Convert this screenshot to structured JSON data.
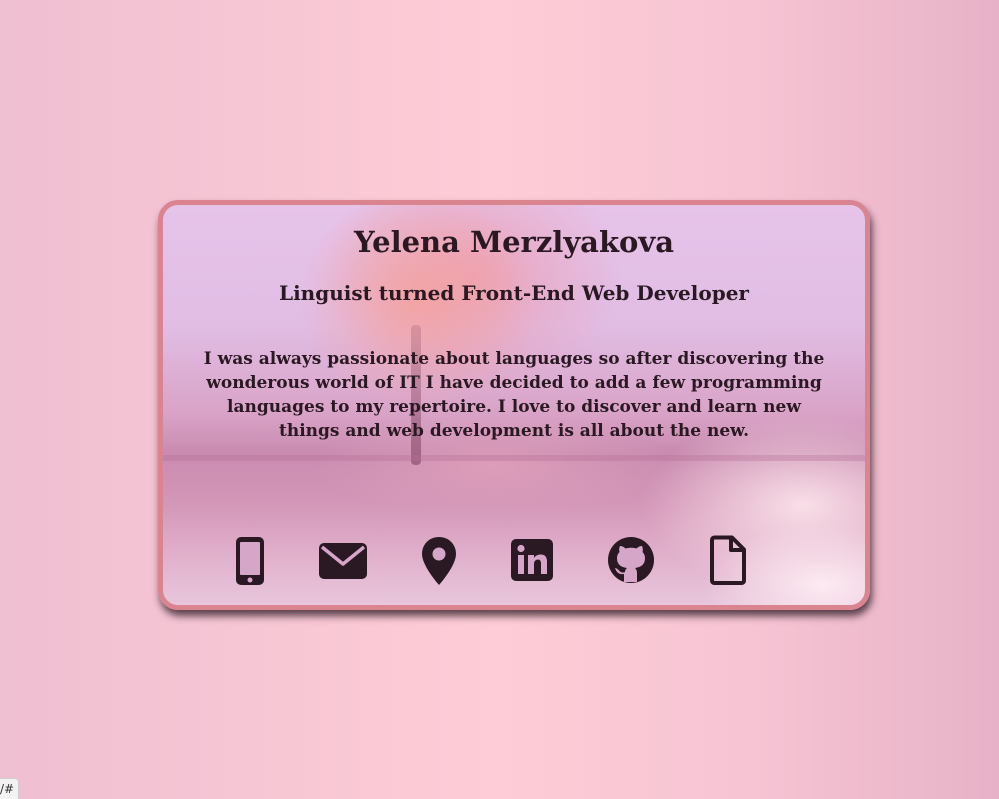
{
  "card": {
    "name": "Yelena Merzlyakova",
    "subtitle": "Linguist turned Front-End Web Developer",
    "bio": "I was always passionate about languages so after discovering the wonderous world of IT I have decided to add a few programming languages to my repertoire. I love to discover and learn new things and web development is all about the new.",
    "contact_icons": [
      "phone-icon",
      "email-icon",
      "location-icon",
      "linkedin-icon",
      "github-icon",
      "file-icon"
    ]
  },
  "status_bar": {
    "url": "/#"
  },
  "colors": {
    "text": "#2a1822",
    "card_border": "#d9848f",
    "page_background": "#fdccd6"
  }
}
